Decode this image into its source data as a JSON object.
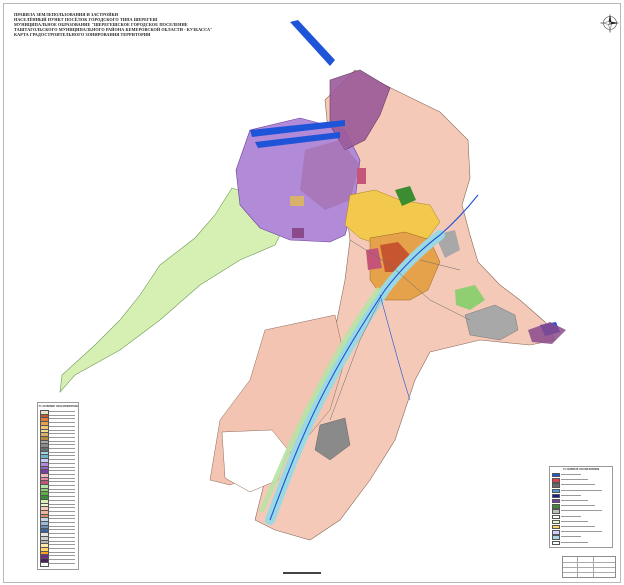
{
  "title_lines": [
    "ПРАВИЛА ЗЕМЛЕПОЛЬЗОВАНИЯ И ЗАСТРОЙКИ",
    "НАСЕЛЁННЫЙ ПУНКТ ПОСЁЛОК ГОРОДСКОГО ТИПА ШЕРЕГЕШ",
    "МУНИЦИПАЛЬНОЕ ОБРАЗОВАНИЕ \"ШЕРЕГЕШСКОЕ ГОРОДСКОЕ ПОСЕЛЕНИЕ",
    "ТАШТАГОЛЬСКОГО МУНИЦИПАЛЬНОГО РАЙОНА КЕМЕРОВСКОЙ ОБЛАСТИ - КУЗБАССА\"",
    "КАРТА ГРАДОСТРОИТЕЛЬНОГО ЗОНИРОВАНИЯ ТЕРРИТОРИИ"
  ],
  "legend_left": {
    "title": "УСЛОВНЫЕ ОБОЗНАЧЕНИЯ",
    "swatches": [
      "#e9e6c4",
      "#c7552f",
      "#e07d3a",
      "#e5a24a",
      "#f0c870",
      "#f2dd8e",
      "#d8b26a",
      "#b48a3c",
      "#a8a8a8",
      "#8a8a8a",
      "#6c6c6c",
      "#9ad9e3",
      "#6fb6c9",
      "#c9c9ff",
      "#b18ad8",
      "#9462c4",
      "#7a3f9c",
      "#f2b8c6",
      "#e58fa5",
      "#c45478",
      "#b8e3a6",
      "#8fcf72",
      "#5fae48",
      "#3c8c32",
      "#d6f0b4",
      "#e8f7c9",
      "#f4c9b8",
      "#efb49b",
      "#d68f6f",
      "#c8d7e8",
      "#9fb8d3",
      "#6c8fb7",
      "#3d63a0",
      "#e4e4e4",
      "#cccccc",
      "#b4b4b4",
      "#ffe9a8",
      "#ffd466",
      "#ff9f1f",
      "#6b2e82",
      "#4a2260",
      "#ffffff"
    ]
  },
  "legend_right": {
    "title": "УСЛОВНЫЕ ОБОЗНАЧЕНИЯ",
    "swatches": [
      "#1e54d8",
      "#e04050",
      "#6a6a6a",
      "#4b9fd6",
      "#1a1a9a",
      "#7a3f9c",
      "#3c8c32",
      "#c0c0c0",
      "#ffffff",
      "#e8f7c9",
      "#ffd466",
      "#d0d0ff",
      "#aad4e8",
      "#ffffff"
    ]
  },
  "colors": {
    "border_zone": "#f4c9b8",
    "agri": "#d6f0b4",
    "recreation": "#b18ad8",
    "residential": "#f2c94c",
    "industrial": "#a8a8a8",
    "water": "#1e54d8",
    "river_buffer": "#9ad9e3",
    "special": "#8a4a8c",
    "forest": "#8fcf72"
  }
}
